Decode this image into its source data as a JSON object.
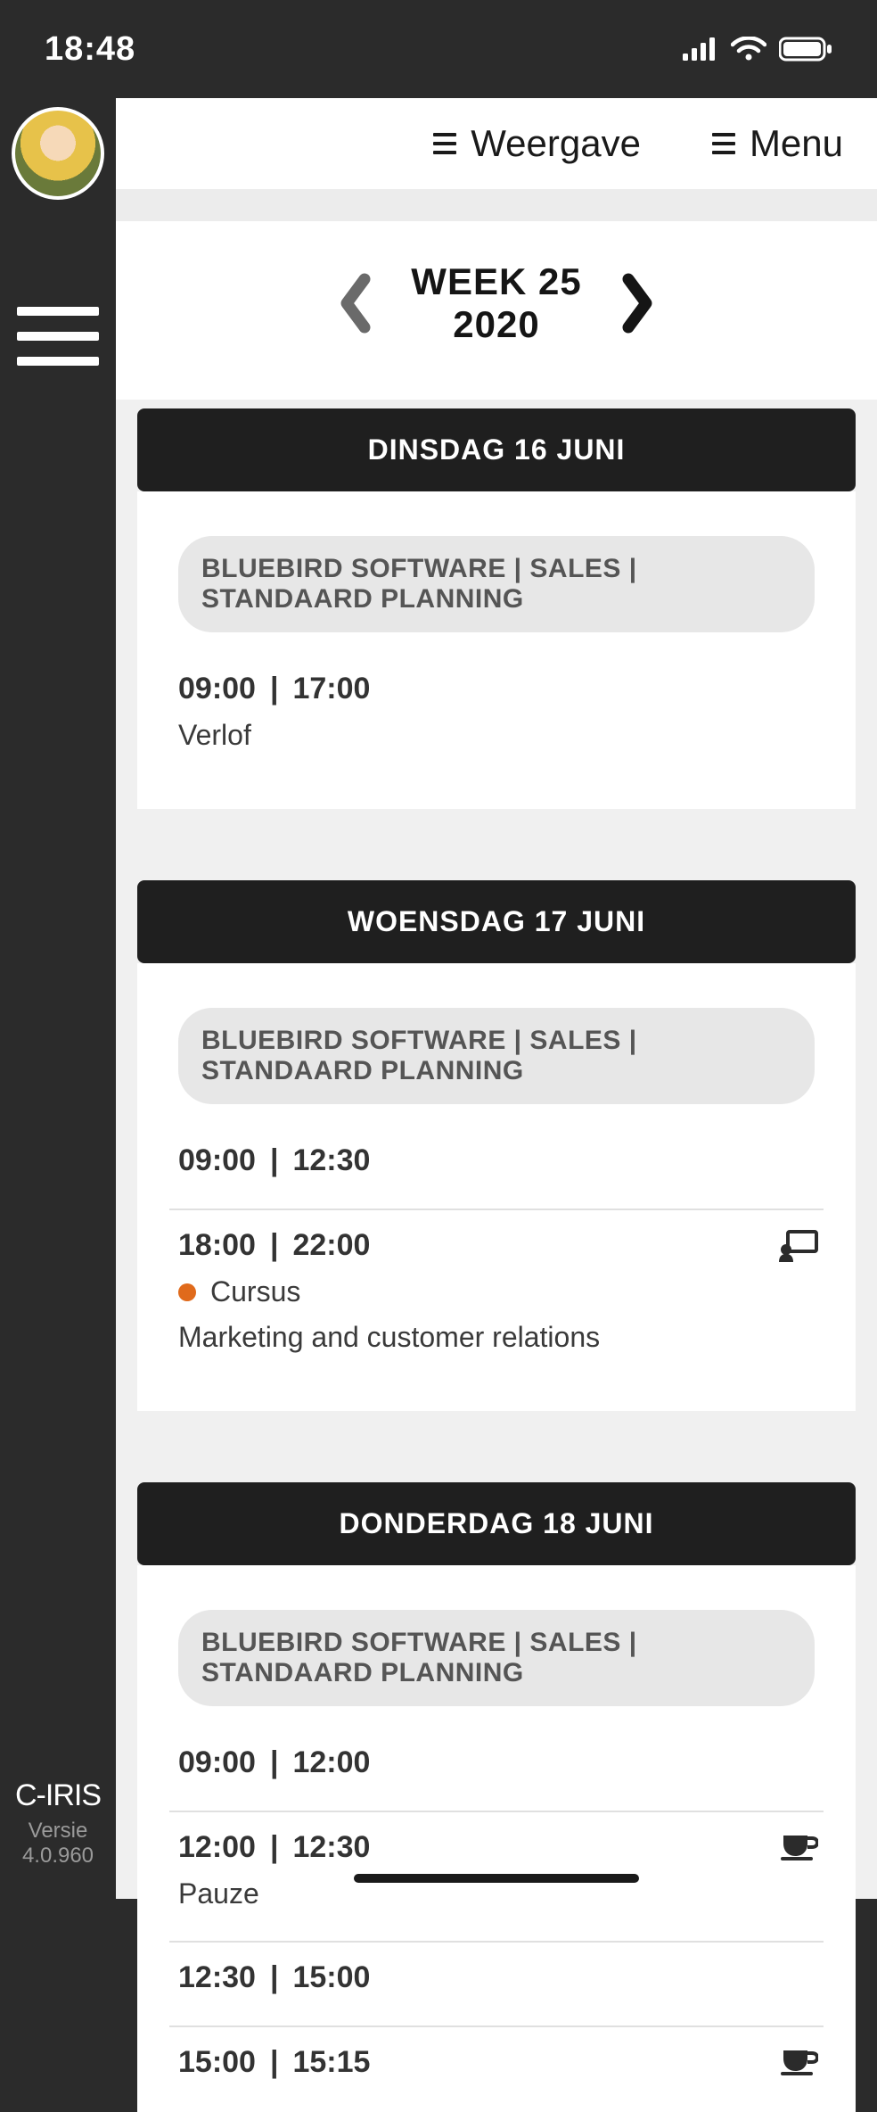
{
  "statusbar": {
    "time": "18:48"
  },
  "footer": {
    "brand": "C-IRIS",
    "version_label": "Versie",
    "version_num": "4.0.960"
  },
  "topmenu": {
    "weergave": "Weergave",
    "menu": "Menu"
  },
  "weeknav": {
    "week_label": "WEEK 25",
    "year": "2020"
  },
  "days": [
    {
      "header": "DINSDAG 16 JUNI",
      "category": "BLUEBIRD SOFTWARE | SALES | STANDAARD PLANNING",
      "slots": [
        {
          "start": "09:00",
          "end": "17:00",
          "label": "Verlof"
        }
      ]
    },
    {
      "header": "WOENSDAG 17 JUNI",
      "category": "BLUEBIRD SOFTWARE | SALES | STANDAARD PLANNING",
      "slots": [
        {
          "start": "09:00",
          "end": "12:30"
        },
        {
          "start": "18:00",
          "end": "22:00",
          "tag": "Cursus",
          "dot": "#e06a1b",
          "sub": "Marketing and customer relations",
          "icon": "teach"
        }
      ]
    },
    {
      "header": "DONDERDAG 18 JUNI",
      "category": "BLUEBIRD SOFTWARE | SALES | STANDAARD PLANNING",
      "slots": [
        {
          "start": "09:00",
          "end": "12:00"
        },
        {
          "start": "12:00",
          "end": "12:30",
          "label": "Pauze",
          "icon": "coffee"
        },
        {
          "start": "12:30",
          "end": "15:00"
        },
        {
          "start": "15:00",
          "end": "15:15",
          "icon": "coffee"
        }
      ]
    }
  ]
}
